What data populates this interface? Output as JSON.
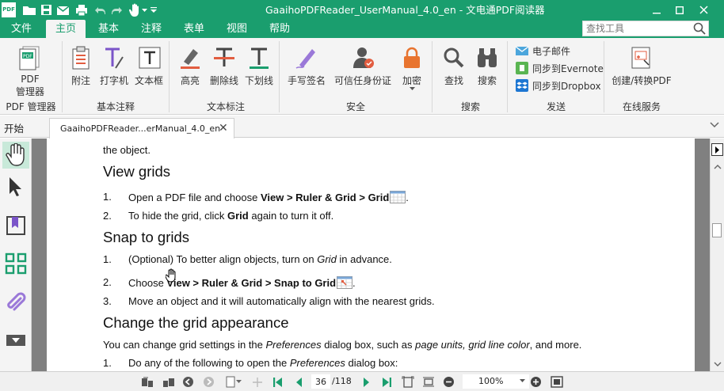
{
  "app": {
    "logo_text": "PDF",
    "window_title": "GaaihoPDFReader_UserManual_4.0_en - 文电通PDF阅读器"
  },
  "menu": {
    "tabs": [
      {
        "label": "文件"
      },
      {
        "label": "主页"
      },
      {
        "label": "基本"
      },
      {
        "label": "注释"
      },
      {
        "label": "表单"
      },
      {
        "label": "视图"
      },
      {
        "label": "帮助"
      }
    ],
    "active": "主页",
    "search_placeholder": "查找工具"
  },
  "ribbon": {
    "pdf_manager": {
      "line1": "PDF",
      "line2": "管理器",
      "group": "PDF 管理器"
    },
    "basic_annot": {
      "items": [
        "附注",
        "打字机",
        "文本框"
      ],
      "group": "基本注释"
    },
    "text_markup": {
      "items": [
        "高亮",
        "删除线",
        "下划线"
      ],
      "group": "文本标注"
    },
    "security": {
      "items": [
        "手写签名",
        "可信任身份证",
        "加密"
      ],
      "group": "安全"
    },
    "search": {
      "items": [
        "查找",
        "搜索"
      ],
      "group": "搜索"
    },
    "send": {
      "items": [
        "电子邮件",
        "同步到Evernote",
        "同步到Dropbox"
      ],
      "group": "发送"
    },
    "online": {
      "items": [
        "创建/转换PDF"
      ],
      "group": "在线服务"
    }
  },
  "tabstrip": {
    "start_label": "开始",
    "doc_tab_title": "GaaihoPDFReader...erManual_4.0_en",
    "close_glyph": "✕"
  },
  "document": {
    "line_top": "the object.",
    "h1": "View grids",
    "steps1": [
      {
        "num": "1.",
        "pre": "Open a PDF file and choose ",
        "b1": "View",
        "m1": " > ",
        "b2": "Ruler & Grid",
        "m2": " > ",
        "b3": "Grid",
        "post": "."
      },
      {
        "num": "2.",
        "pre": "To hide the grid, click ",
        "b1": "Grid",
        "post": " again to turn it off."
      }
    ],
    "h2": "Snap to grids",
    "steps2": [
      {
        "num": "1.",
        "pre": "(Optional) To better align objects, turn on ",
        "i1": "Grid",
        "post": " in advance."
      },
      {
        "num": "2.",
        "pre": "Choose ",
        "b1": "View",
        "m1": " > ",
        "b2": "Ruler & Grid",
        "m2": " > ",
        "b3": "Snap to Grid",
        "post": "."
      },
      {
        "num": "3.",
        "pre": "Move an object and it will automatically align with the nearest grids."
      }
    ],
    "h3": "Change the grid appearance",
    "para": {
      "pre": "You can change grid settings in the ",
      "i1": "Preferences",
      "mid": " dialog box, such as ",
      "i2": "page units, grid line color",
      "post": ", and more."
    },
    "steps3": [
      {
        "num": "1.",
        "pre": "Do any of the following to open the ",
        "i1": "Preferences",
        "post": " dialog box:"
      }
    ]
  },
  "bottombar": {
    "current_page": "36",
    "total_pages": "/118",
    "zoom": "100%"
  },
  "colors": {
    "brand": "#1a9e6e",
    "ribbon_bg": "#f4f4f4",
    "sidebar_active": "#c8e9d9",
    "doc_bg": "#808080"
  }
}
